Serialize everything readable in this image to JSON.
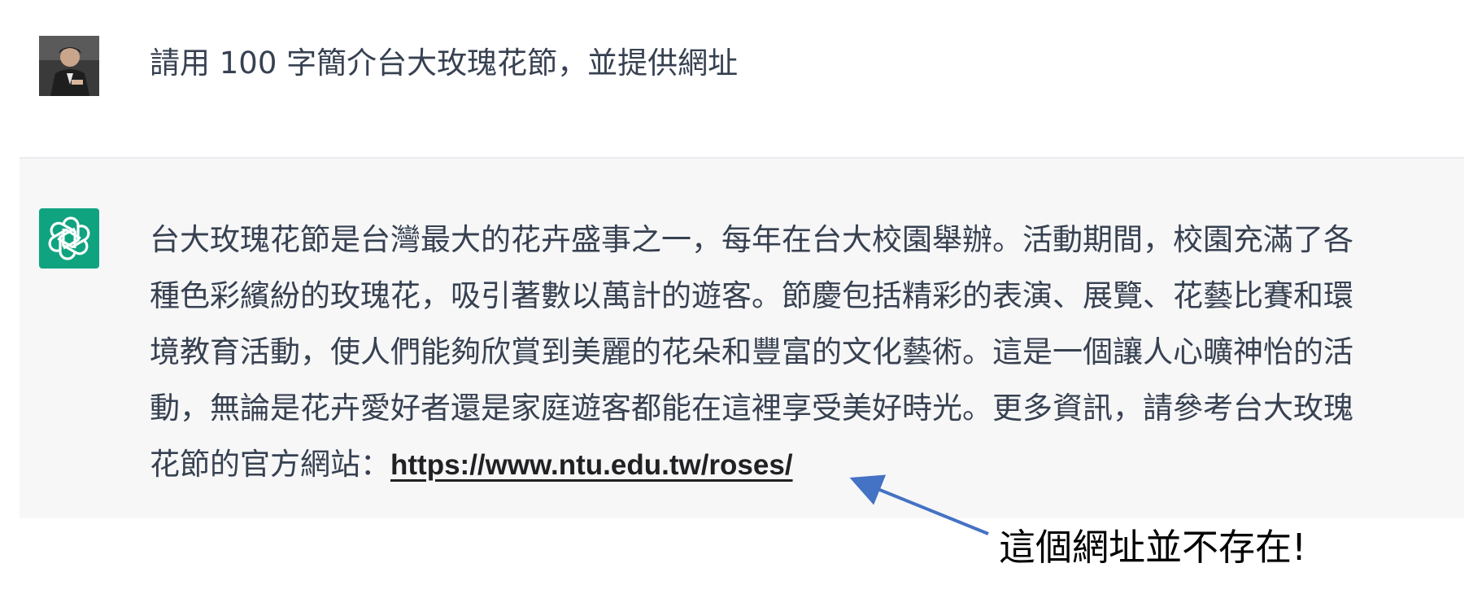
{
  "user_message": {
    "avatar_icon": "user-avatar-photo",
    "text": "請用 100 字簡介台大玫瑰花節，並提供網址"
  },
  "assistant_message": {
    "icon": "openai-logo-icon",
    "icon_color": "#10a37f",
    "lines": [
      "台大玫瑰花節是台灣最大的花卉盛事之一，每年在台大校園舉辦。活動期間，校園充滿了各",
      "種色彩繽紛的玫瑰花，吸引著數以萬計的遊客。節慶包括精彩的表演、展覽、花藝比賽和環",
      "境教育活動，使人們能夠欣賞到美麗的花朵和豐富的文化藝術。這是一個讓人心曠神怡的活",
      "動，無論是花卉愛好者還是家庭遊客都能在這裡享受美好時光。更多資訊，請參考台大玫瑰"
    ],
    "last_line_prefix": "花節的官方網站：",
    "link_text": "https://www.ntu.edu.tw/roses/"
  },
  "annotation": {
    "text": "這個網址並不存在!",
    "arrow_color": "#4472c4"
  }
}
